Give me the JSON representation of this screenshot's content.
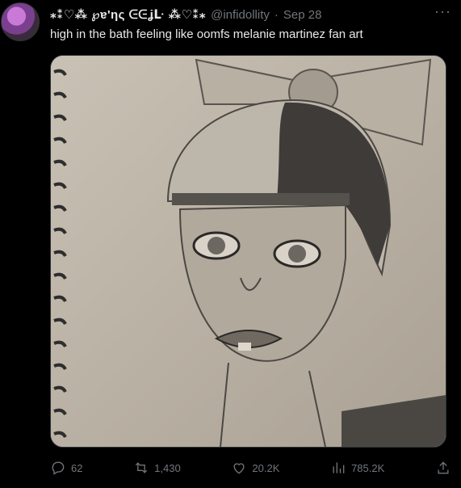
{
  "tweet": {
    "display_name": "⁎⁑♡⁂ ℘ɐ'ƞς ᕮᕮʝᒷ ⁂♡⁑⁎",
    "handle": "@infidollity",
    "separator": "·",
    "time": "Sep 28",
    "text": "high in the bath feeling like oomfs melanie martinez fan art",
    "more_icon": "more-horizontal-icon"
  },
  "actions": {
    "replies": "62",
    "reposts": "1,430",
    "likes": "20.2K",
    "views": "785.2K"
  },
  "icons": {
    "reply": "reply-icon",
    "repost": "repost-icon",
    "like": "heart-icon",
    "views": "views-icon",
    "share": "share-icon"
  },
  "colors": {
    "background": "#000000",
    "text": "#e7e9ea",
    "muted": "#71767b",
    "border": "#2f3336"
  }
}
